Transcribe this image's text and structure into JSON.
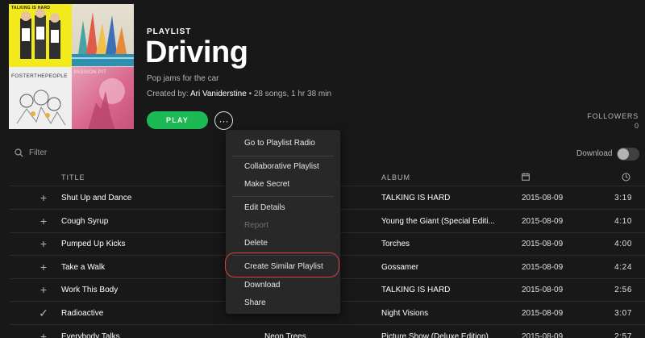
{
  "cover": {
    "tile1_text": "TALKING IS HARD",
    "tile3_text": "FOSTERTHEPEOPLE",
    "tile4_text": "PASSION PIT"
  },
  "playlist": {
    "type_label": "PLAYLIST",
    "title": "Driving",
    "description": "Pop jams for the car",
    "created_by_prefix": "Created by:",
    "owner": "Ari Vaniderstine",
    "stats": " • 28 songs, 1 hr 38 min"
  },
  "actions": {
    "play_label": "PLAY",
    "more_label": "···"
  },
  "followers": {
    "label": "FOLLOWERS",
    "count": "0"
  },
  "filter": {
    "placeholder": "Filter",
    "icon": "search-icon"
  },
  "download": {
    "label": "Download",
    "enabled": false
  },
  "table": {
    "headers": {
      "title": "TITLE",
      "album": "ALBUM",
      "date_icon": "calendar-icon",
      "duration_icon": "clock-icon"
    },
    "rows": [
      {
        "action": "+",
        "title": "Shut Up and Dance",
        "artist": "",
        "album": "TALKING IS HARD",
        "date": "2015-08-09",
        "duration": "3:19"
      },
      {
        "action": "+",
        "title": "Cough Syrup",
        "artist": "",
        "album": "Young the Giant (Special Editi...",
        "date": "2015-08-09",
        "duration": "4:10"
      },
      {
        "action": "+",
        "title": "Pumped Up Kicks",
        "artist": "",
        "album": "Torches",
        "date": "2015-08-09",
        "duration": "4:00"
      },
      {
        "action": "+",
        "title": "Take a Walk",
        "artist": "",
        "album": "Gossamer",
        "date": "2015-08-09",
        "duration": "4:24"
      },
      {
        "action": "+",
        "title": "Work This Body",
        "artist": "",
        "album": "TALKING IS HARD",
        "date": "2015-08-09",
        "duration": "2:56"
      },
      {
        "action": "✓",
        "title": "Radioactive",
        "artist": "",
        "album": "Night Visions",
        "date": "2015-08-09",
        "duration": "3:07"
      },
      {
        "action": "+",
        "title": "Everybody Talks",
        "artist": "Neon Trees",
        "album": "Picture Show (Deluxe Edition)",
        "date": "2015-08-09",
        "duration": "2:57"
      }
    ]
  },
  "context_menu": {
    "items": [
      {
        "label": "Go to Playlist Radio",
        "enabled": true
      },
      {
        "label": "Collaborative Playlist",
        "enabled": true
      },
      {
        "label": "Make Secret",
        "enabled": true
      },
      {
        "label": "Edit Details",
        "enabled": true
      },
      {
        "label": "Report",
        "enabled": false
      },
      {
        "label": "Delete",
        "enabled": true
      },
      {
        "label": "Create Similar Playlist",
        "enabled": true
      },
      {
        "label": "Download",
        "enabled": true
      },
      {
        "label": "Share",
        "enabled": true
      }
    ]
  },
  "colors": {
    "background": "#181818",
    "accent": "#1db954",
    "highlight_ring": "#d9403a",
    "menu_background": "#282828"
  }
}
